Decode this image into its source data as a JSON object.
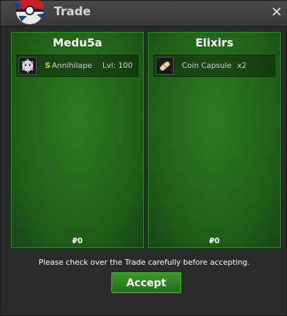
{
  "window": {
    "title": "Trade",
    "close_symbol": "✕"
  },
  "left_panel": {
    "title": "Medu5a",
    "item": {
      "coin_mark": "S",
      "name": "Annihilape",
      "level_label": "Lvl: 100",
      "icon": "pokemon-annihilape-icon"
    },
    "money": "₽0"
  },
  "right_panel": {
    "title": "Elixirs",
    "item": {
      "name": "Coin Capsule",
      "quantity": "x2",
      "icon": "coin-capsule-icon"
    },
    "money": "₽0"
  },
  "notice": "Please check over the Trade carefully before accepting.",
  "accept_label": "Accept",
  "colors": {
    "panel_green": "#2e7a22",
    "button_green": "#3d9a2c",
    "coin_gold": "#e8c23a"
  }
}
